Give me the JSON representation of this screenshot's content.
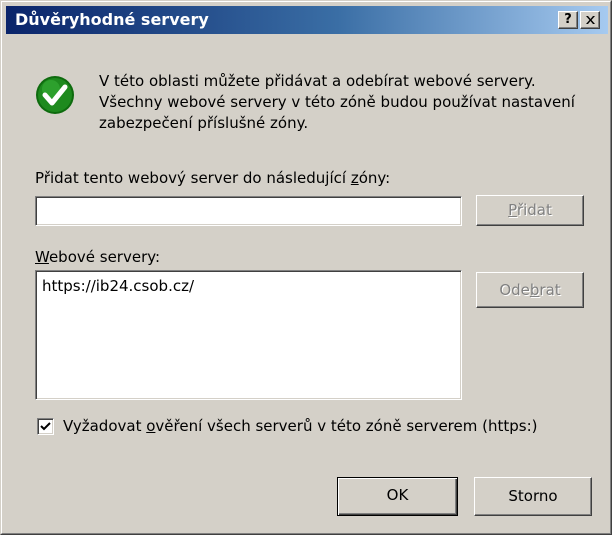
{
  "window": {
    "title": "Důvěryhodné servery",
    "help_label": "?"
  },
  "info": {
    "lines": [
      "V této oblasti můžete přidávat a odebírat webové servery.",
      "Všechny webové servery v této zóně budou používat nastavení",
      "zabezpečení příslušné zóny."
    ]
  },
  "zone": {
    "label_before": "Přidat tento webový server do následující ",
    "label_mnemonic": "z",
    "label_after": "óny:",
    "input_value": ""
  },
  "buttons": {
    "add_pre": "",
    "add_mnemonic": "P",
    "add_post": "řidat",
    "remove_pre": "Ode",
    "remove_mnemonic": "b",
    "remove_post": "rat",
    "ok": "OK",
    "cancel": "Storno"
  },
  "servers": {
    "label_mnemonic": "W",
    "label_rest": "ebové servery:",
    "items": [
      "https://ib24.csob.cz/"
    ]
  },
  "require_https": {
    "checked": true,
    "label_pre": "Vyžadovat ",
    "label_mnemonic": "o",
    "label_post": "věření všech serverů v této zóně serverem (https:)"
  },
  "icons": {
    "info": "checkmark-icon",
    "close": "close-icon",
    "help": "help-icon",
    "check": "check-icon"
  },
  "colors": {
    "titlebar_start": "#0a246a",
    "titlebar_end": "#a6caf0",
    "dialog_bg": "#d4d0c8",
    "icon_green": "#1e8a1e"
  }
}
